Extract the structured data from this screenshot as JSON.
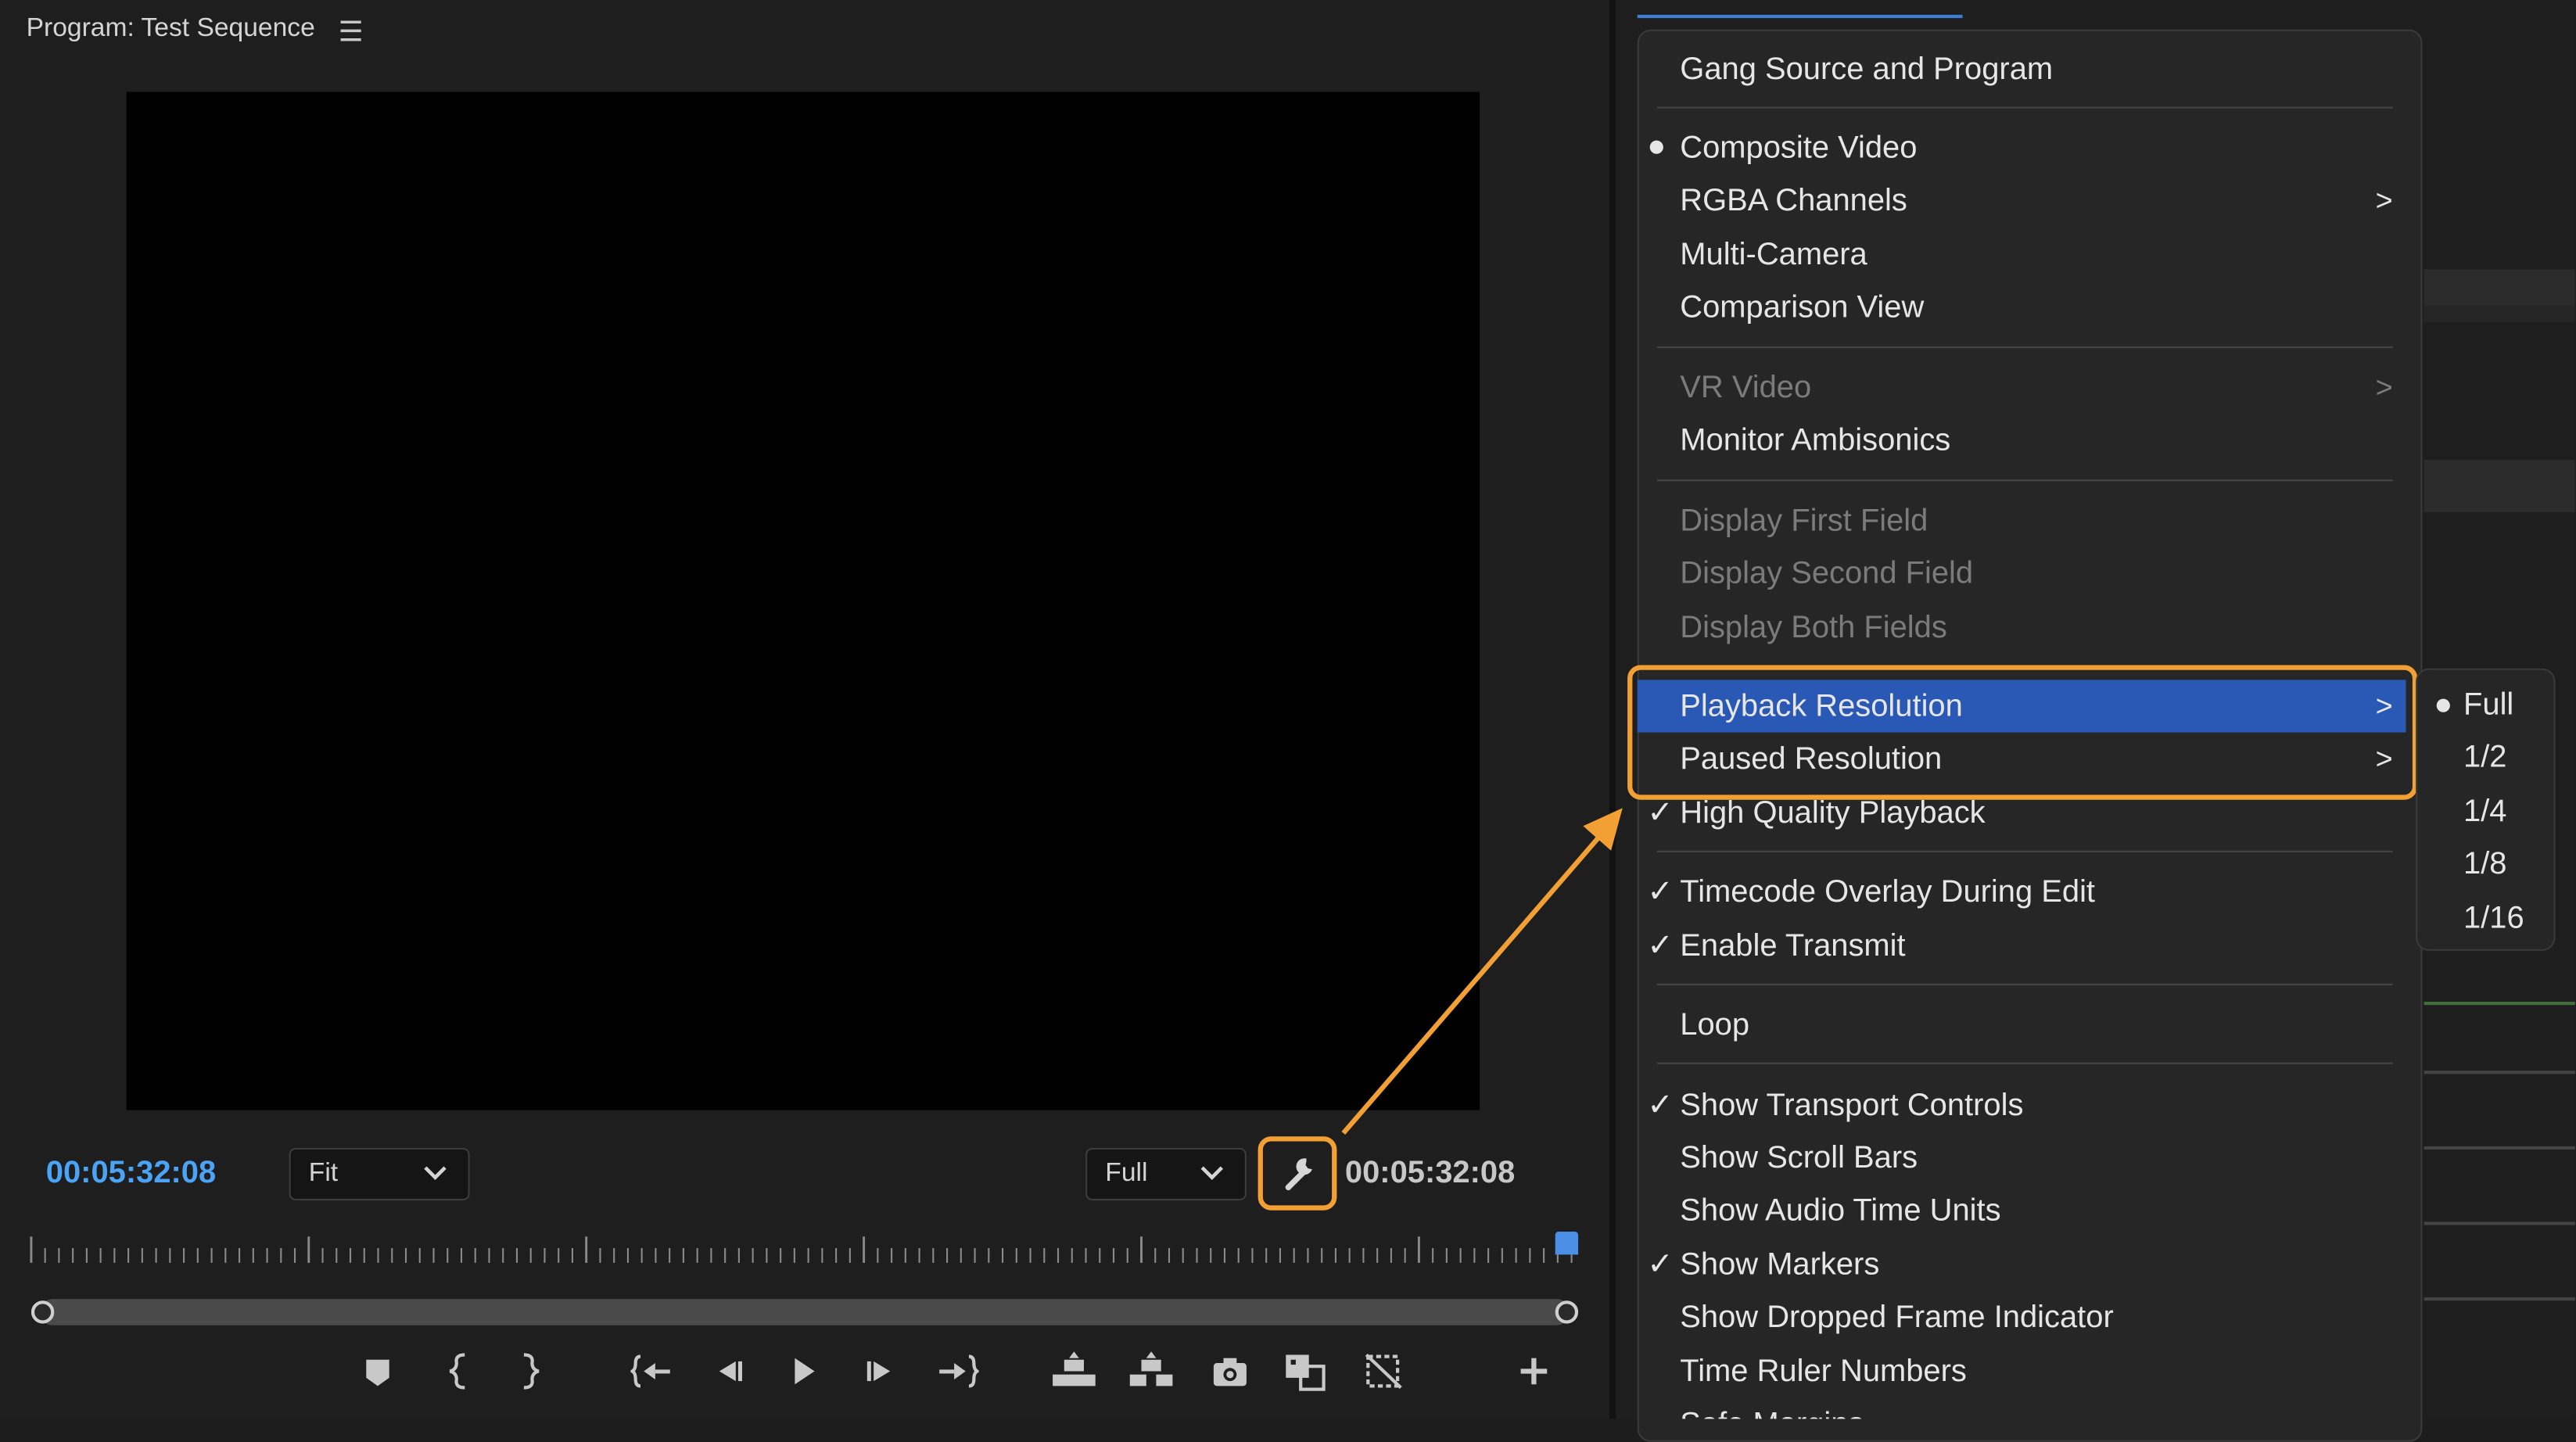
{
  "colors": {
    "accent_blue": "#4aa3f5",
    "menu_highlight": "#2a58b5",
    "annotation_orange": "#f2a033",
    "video_bg": "#000000"
  },
  "monitor": {
    "title": "Program: Test Sequence",
    "menu_icon": "hamburger-icon",
    "timecode_left": "00:05:32:08",
    "timecode_right": "00:05:32:08",
    "zoom_dropdown": {
      "value": "Fit"
    },
    "resolution_dropdown": {
      "value": "Full"
    },
    "settings_button_icon": "wrench-icon",
    "scroll_position": 1.0,
    "transport_buttons": [
      {
        "icon": "add-marker-icon"
      },
      {
        "icon": "mark-in-icon"
      },
      {
        "icon": "mark-out-icon"
      },
      {
        "icon": "go-to-in-icon"
      },
      {
        "icon": "step-back-icon"
      },
      {
        "icon": "play-icon"
      },
      {
        "icon": "step-forward-icon"
      },
      {
        "icon": "go-to-out-icon"
      },
      {
        "icon": "lift-icon"
      },
      {
        "icon": "extract-icon"
      },
      {
        "icon": "export-frame-icon"
      },
      {
        "icon": "comparison-view-icon"
      },
      {
        "icon": "toggle-proxies-icon"
      },
      {
        "icon": "add-button-icon"
      }
    ]
  },
  "menu": {
    "items": [
      {
        "label": "Gang Source and Program",
        "enabled": true
      },
      {
        "label": "Composite Video",
        "mark": "●",
        "enabled": true
      },
      {
        "label": "RGBA Channels",
        "submenu": true,
        "enabled": true
      },
      {
        "label": "Multi-Camera",
        "enabled": true
      },
      {
        "label": "Comparison View",
        "enabled": true
      },
      {
        "label": "VR Video",
        "submenu": true,
        "enabled": false
      },
      {
        "label": "Monitor Ambisonics",
        "enabled": true
      },
      {
        "label": "Display First Field",
        "enabled": false
      },
      {
        "label": "Display Second Field",
        "enabled": false
      },
      {
        "label": "Display Both Fields",
        "enabled": false
      },
      {
        "label": "Playback Resolution",
        "submenu": true,
        "enabled": true,
        "highlighted": true
      },
      {
        "label": "Paused Resolution",
        "submenu": true,
        "enabled": true
      },
      {
        "label": "High Quality Playback",
        "mark": "✓",
        "enabled": true
      },
      {
        "label": "Timecode Overlay During Edit",
        "mark": "✓",
        "enabled": true
      },
      {
        "label": "Enable Transmit",
        "mark": "✓",
        "enabled": true
      },
      {
        "label": "Loop",
        "enabled": true
      },
      {
        "label": "Show Transport Controls",
        "mark": "✓",
        "enabled": true
      },
      {
        "label": "Show Scroll Bars",
        "enabled": true
      },
      {
        "label": "Show Audio Time Units",
        "enabled": true
      },
      {
        "label": "Show Markers",
        "mark": "✓",
        "enabled": true
      },
      {
        "label": "Show Dropped Frame Indicator",
        "enabled": true
      },
      {
        "label": "Time Ruler Numbers",
        "enabled": true
      },
      {
        "label": "Safe Margins",
        "enabled": true
      }
    ],
    "submenu_arrow": ">"
  },
  "submenu": {
    "items": [
      {
        "label": "Full",
        "mark": "●"
      },
      {
        "label": "1/2"
      },
      {
        "label": "1/4"
      },
      {
        "label": "1/8"
      },
      {
        "label": "1/16"
      }
    ]
  }
}
